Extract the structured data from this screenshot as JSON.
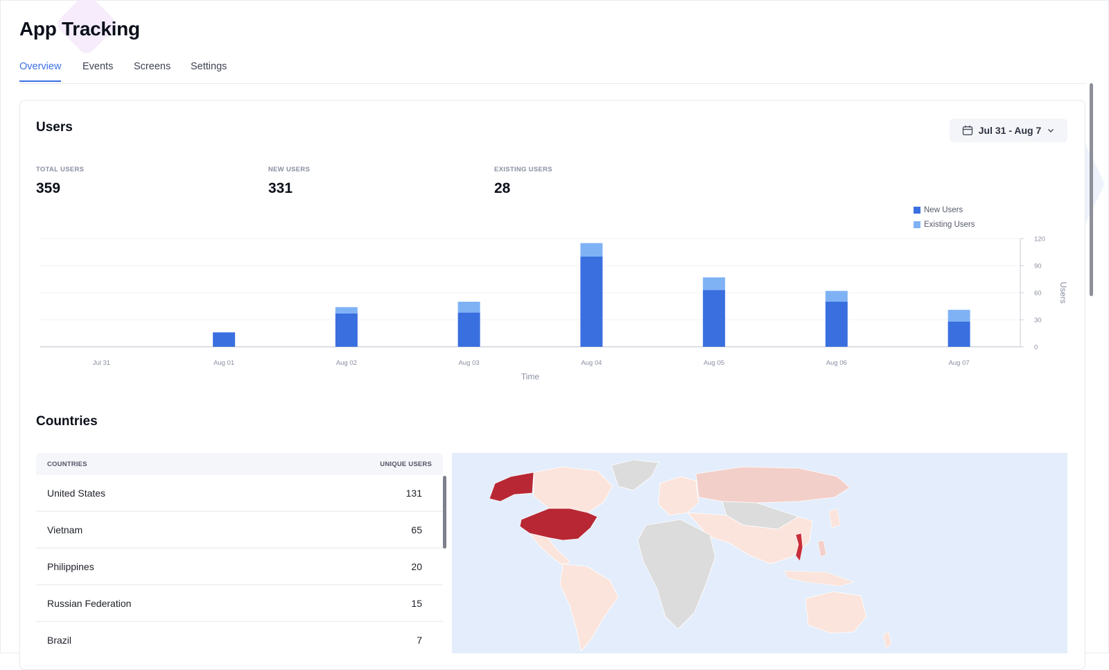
{
  "app": {
    "title": "App Tracking"
  },
  "tabs": [
    {
      "label": "Overview",
      "active": true
    },
    {
      "label": "Events",
      "active": false
    },
    {
      "label": "Screens",
      "active": false
    },
    {
      "label": "Settings",
      "active": false
    }
  ],
  "users": {
    "section_title": "Users",
    "date_range": "Jul 31 - Aug 7",
    "date_icon": "calendar-icon",
    "stats": [
      {
        "label": "TOTAL USERS",
        "value": "359"
      },
      {
        "label": "NEW USERS",
        "value": "331"
      },
      {
        "label": "EXISTING USERS",
        "value": "28"
      }
    ]
  },
  "chart_data": {
    "type": "bar",
    "stacked": true,
    "categories": [
      "Jul 31",
      "Aug 01",
      "Aug 02",
      "Aug 03",
      "Aug 04",
      "Aug 05",
      "Aug 06",
      "Aug 07"
    ],
    "series": [
      {
        "name": "New Users",
        "color": "#3a6fe0",
        "values": [
          0,
          16,
          37,
          38,
          100,
          63,
          50,
          28
        ]
      },
      {
        "name": "Existing Users",
        "color": "#7fb2f5",
        "values": [
          0,
          0,
          7,
          12,
          15,
          14,
          12,
          13
        ]
      }
    ],
    "xlabel": "Time",
    "ylabel": "Users",
    "ylim": [
      0,
      120
    ],
    "yticks": [
      0,
      30,
      60,
      90,
      120
    ],
    "grid": true,
    "legend_position": "top-right"
  },
  "countries": {
    "section_title": "Countries",
    "columns": [
      "COUNTRIES",
      "UNIQUE USERS"
    ],
    "rows": [
      {
        "country": "United States",
        "users": "131"
      },
      {
        "country": "Vietnam",
        "users": "65"
      },
      {
        "country": "Philippines",
        "users": "20"
      },
      {
        "country": "Russian Federation",
        "users": "15"
      },
      {
        "country": "Brazil",
        "users": "7"
      }
    ],
    "map_colors": {
      "ocean": "#e3edfb",
      "no_data": "#dcdcdc",
      "low": "#fbe4dc",
      "mid": "#f3cfca",
      "high": "#b82834"
    }
  }
}
